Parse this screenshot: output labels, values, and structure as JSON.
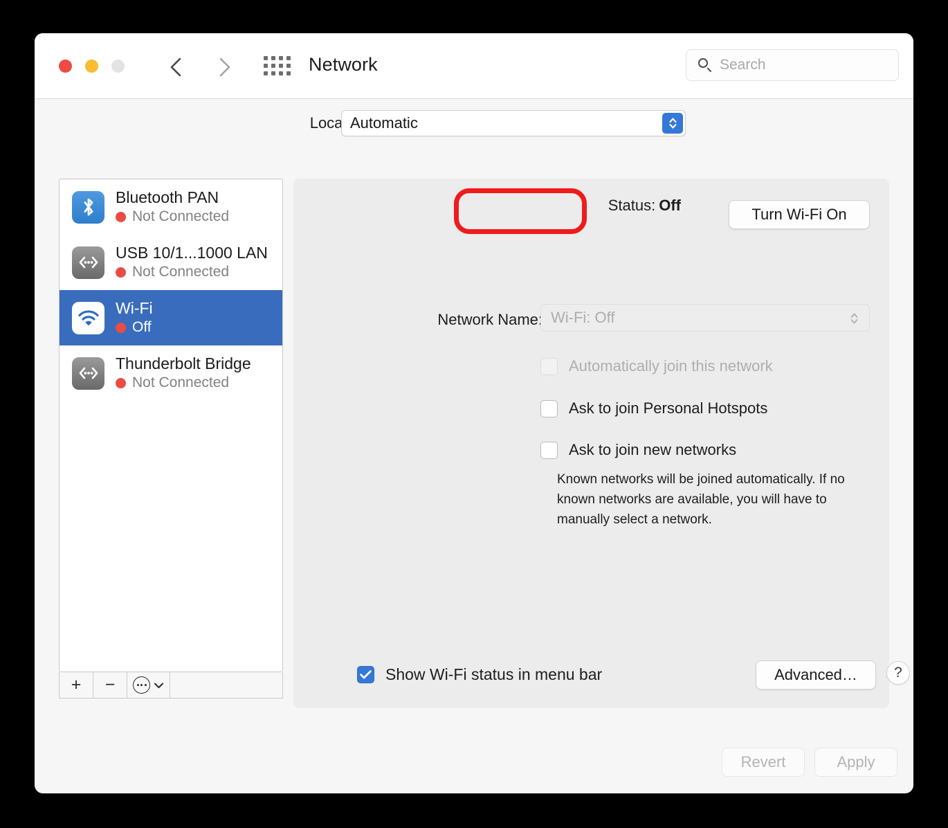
{
  "window": {
    "title": "Network",
    "traffic_lights": [
      "close-red",
      "minimize-yellow",
      "zoom-disabled"
    ],
    "nav_back": "‹",
    "nav_forward": "›",
    "grid_icon": "show-all-grid-icon"
  },
  "search": {
    "placeholder": "Search",
    "value": "",
    "icon": "search-icon"
  },
  "location": {
    "label": "Location:",
    "value": "Automatic",
    "options": [
      "Automatic"
    ]
  },
  "sidebar": {
    "services": [
      {
        "name": "Bluetooth PAN",
        "status": "Not Connected",
        "icon": "bluetooth-icon",
        "selected": false
      },
      {
        "name": "USB 10/1...1000 LAN",
        "status": "Not Connected",
        "icon": "ethernet-icon",
        "selected": false
      },
      {
        "name": "Wi-Fi",
        "status": "Off",
        "icon": "wifi-icon",
        "selected": true
      },
      {
        "name": "Thunderbolt Bridge",
        "status": "Not Connected",
        "icon": "ethernet-icon",
        "selected": false
      }
    ],
    "toolbar": {
      "add_label": "+",
      "remove_label": "−",
      "action_icon": "ellipsis-circle-icon",
      "action_chevron": "chevron-down-icon"
    }
  },
  "main": {
    "status_label": "Status:",
    "status_value": "Off",
    "turn_wifi_label": "Turn Wi-Fi On",
    "network_name_label": "Network Name:",
    "network_name_value": "Wi-Fi: Off",
    "checkboxes": [
      {
        "label": "Automatically join this network",
        "checked": false,
        "disabled": true
      },
      {
        "label": "Ask to join Personal Hotspots",
        "checked": false,
        "disabled": false
      },
      {
        "label": "Ask to join new networks",
        "checked": false,
        "disabled": false
      }
    ],
    "help_text": "Known networks will be joined automatically. If no known networks are available, you will have to manually select a network.",
    "menu_bar_checkbox": {
      "label": "Show Wi-Fi status in menu bar",
      "checked": true
    },
    "advanced_label": "Advanced…",
    "help_label": "?"
  },
  "footer": {
    "revert_label": "Revert",
    "apply_label": "Apply"
  },
  "annotation": {
    "type": "red-rounded-rect-highlight",
    "target": "status-line",
    "color": "#f01b1b"
  },
  "colors": {
    "selection_blue": "#3a6cbe",
    "accent_blue": "#3478d8",
    "status_dot_red": "#ea4c43",
    "annotation_red": "#f01b1b",
    "panel_grey": "#ececec",
    "window_grey": "#f6f6f6"
  }
}
